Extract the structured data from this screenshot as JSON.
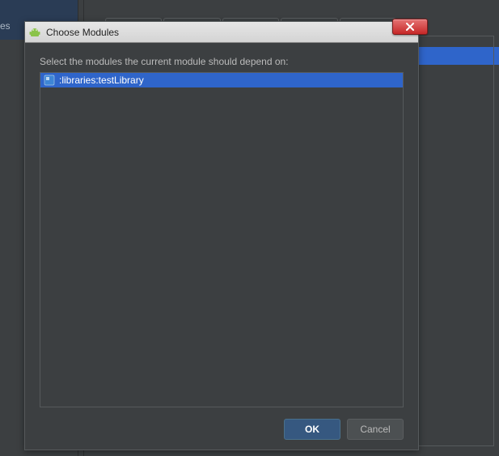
{
  "background": {
    "left_panel_fragment": "es"
  },
  "dialog": {
    "title": "Choose Modules",
    "instruction": "Select the modules the current module should depend on:",
    "modules": [
      {
        "label": ":libraries:testLibrary",
        "selected": true
      }
    ],
    "buttons": {
      "ok": "OK",
      "cancel": "Cancel"
    }
  }
}
